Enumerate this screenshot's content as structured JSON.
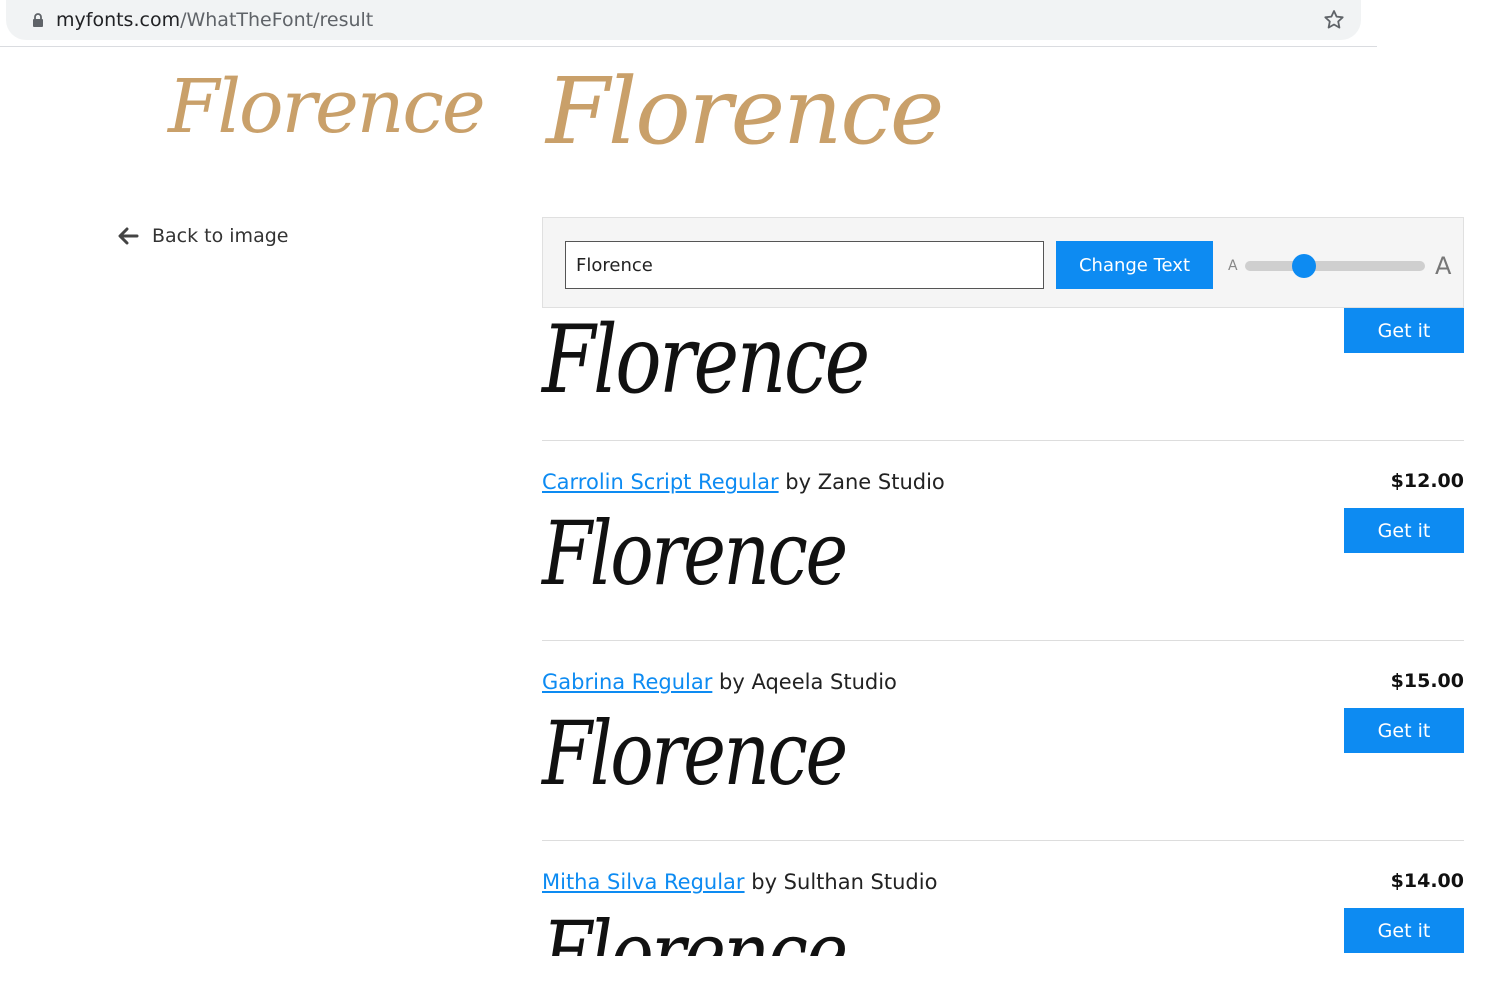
{
  "browser": {
    "url_host": "myfonts.com",
    "url_path": "/WhatTheFont/result"
  },
  "uploaded_sample": {
    "text": "Florence"
  },
  "navigation": {
    "back_label": "Back to image"
  },
  "controls": {
    "text_value": "Florence",
    "change_text_label": "Change Text",
    "size_small_label": "A",
    "size_large_label": "A",
    "size_level_percent": 30
  },
  "results": [
    {
      "preview_text": "Florence",
      "button_label": "Get it"
    },
    {
      "font_name": "Carrolin Script Regular",
      "by": "by Zane Studio",
      "price": "$12.00",
      "preview_text": "Florence",
      "button_label": "Get it"
    },
    {
      "font_name": "Gabrina Regular",
      "by": "by Aqeela Studio",
      "price": "$15.00",
      "preview_text": "Florence",
      "button_label": "Get it"
    },
    {
      "font_name": "Mitha Silva Regular",
      "by": "by Sulthan Studio",
      "price": "$14.00",
      "preview_text": "Florence",
      "button_label": "Get it"
    }
  ],
  "colors": {
    "accent": "#0d8bf2",
    "sample_gold": "#c9a06a"
  }
}
